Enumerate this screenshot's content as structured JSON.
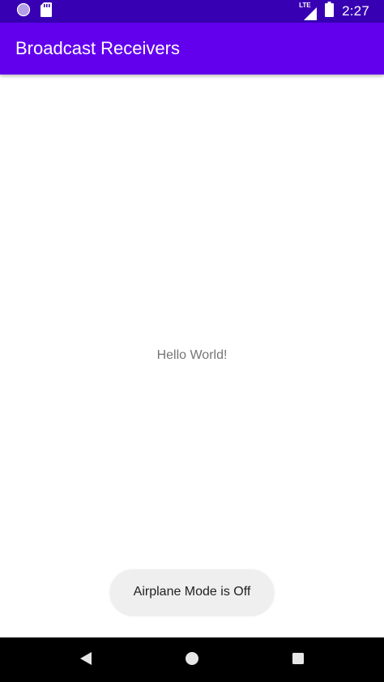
{
  "status_bar": {
    "time": "2:27",
    "network_label": "LTE",
    "icons": [
      "circle-notification-icon",
      "sd-card-icon",
      "lte-signal-icon",
      "battery-icon"
    ]
  },
  "app_bar": {
    "title": "Broadcast Receivers"
  },
  "main": {
    "hello_text": "Hello World!"
  },
  "toast": {
    "message": "Airplane Mode is Off"
  },
  "nav_bar": {
    "icons": [
      "back-icon",
      "home-icon",
      "recents-icon"
    ]
  },
  "colors": {
    "status_bar": "#3700b3",
    "app_bar": "#6200ee",
    "background": "#ffffff",
    "toast_background": "#efefef",
    "nav_bar": "#000000"
  }
}
